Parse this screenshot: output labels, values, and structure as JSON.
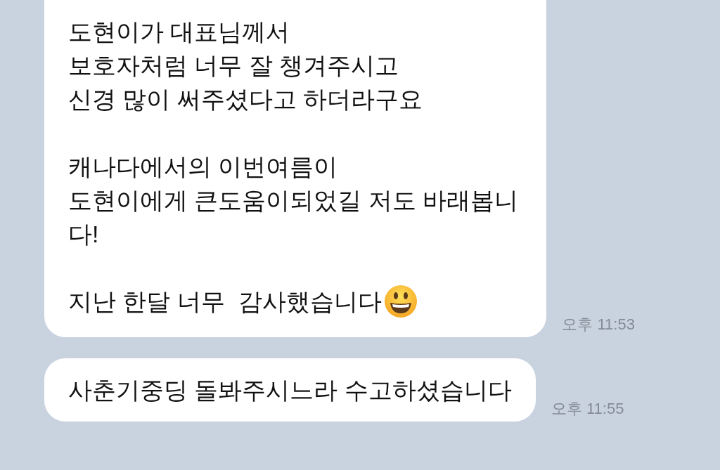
{
  "messages": [
    {
      "text": "도현이가 대표님께서\n보호자처럼 너무 잘 챙겨주시고\n신경 많이 써주셨다고 하더라구요\n\n캐나다에서의 이번여름이\n도현이에게 큰도움이되었길 저도 바래봅니\n다!\n\n지난 한달 너무  감사했습니다",
      "smiley_emoji": true,
      "time": "오후 11:53",
      "cut_top": true
    },
    {
      "text": "사춘기중딩 돌봐주시느라 수고하셨습니다",
      "time": "오후 11:55",
      "smiley_emoji": false,
      "cut_top": false
    }
  ]
}
